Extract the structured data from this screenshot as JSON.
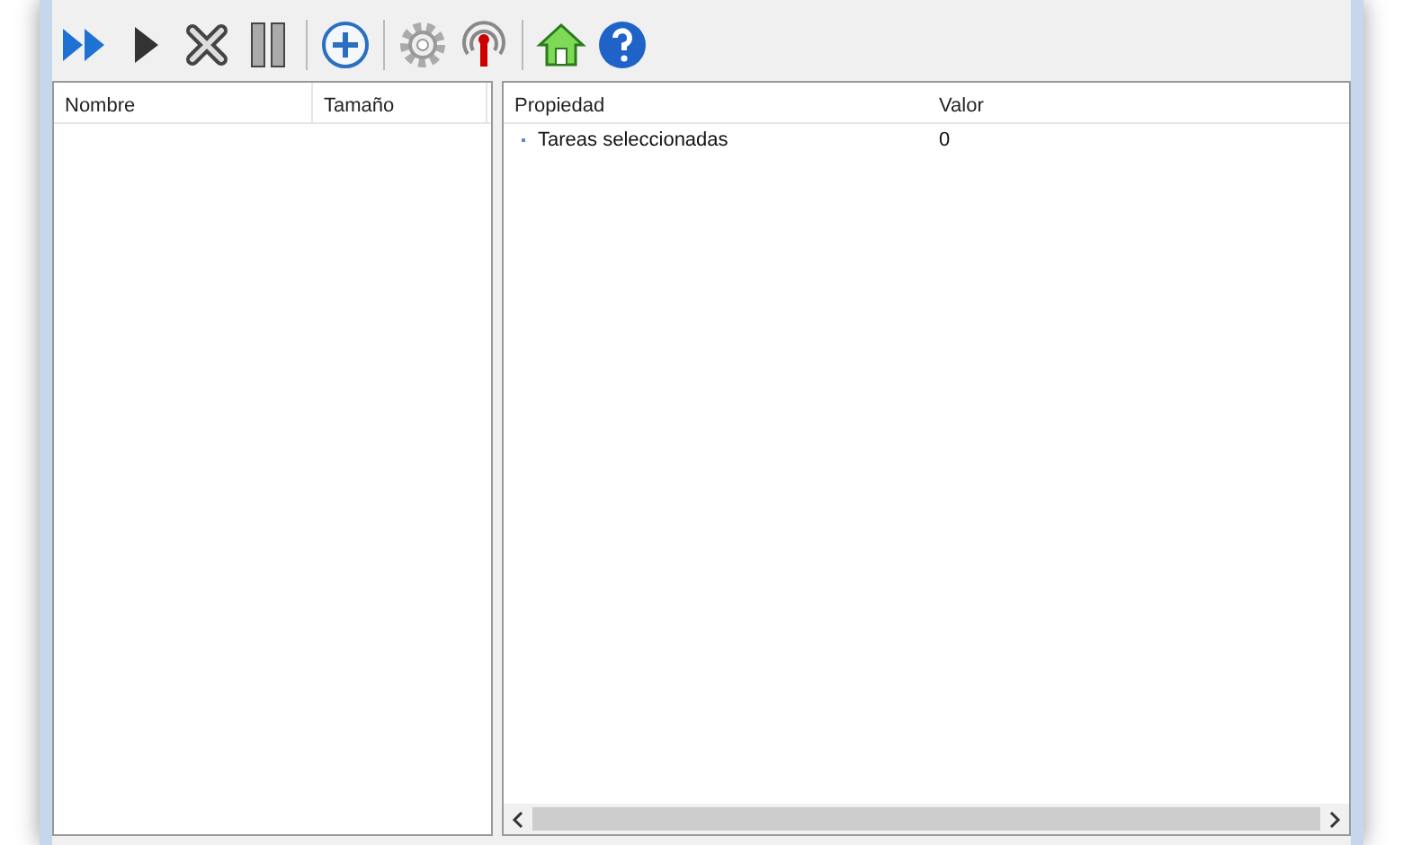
{
  "toolbar": {
    "groups": [
      [
        {
          "kind": "fast-forward"
        },
        {
          "kind": "play"
        },
        {
          "kind": "cancel"
        },
        {
          "kind": "pause"
        }
      ],
      [
        {
          "kind": "add"
        }
      ],
      [
        {
          "kind": "settings"
        },
        {
          "kind": "antenna"
        }
      ],
      [
        {
          "kind": "home"
        },
        {
          "kind": "help"
        }
      ]
    ]
  },
  "left_panel": {
    "columns": [
      "Nombre",
      "Tamaño"
    ]
  },
  "right_panel": {
    "columns": [
      "Propiedad",
      "Valor"
    ],
    "rows": [
      {
        "name": "Tareas seleccionadas",
        "value": "0"
      }
    ]
  }
}
